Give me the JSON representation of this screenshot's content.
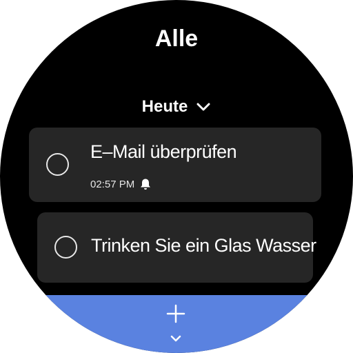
{
  "header": {
    "title": "Alle"
  },
  "section": {
    "label": "Heute",
    "icon": "chevron-down-icon"
  },
  "tasks": [
    {
      "title": "E–Mail überprüfen",
      "time": "02:57 PM",
      "reminder_icon": "bell-icon",
      "completed": false
    },
    {
      "title": "Trinken Sie ein Glas Wasser",
      "completed": false
    }
  ],
  "footer": {
    "add_icon": "plus-icon",
    "more_icon": "chevron-down-icon",
    "accent_color": "#5a82e0"
  }
}
